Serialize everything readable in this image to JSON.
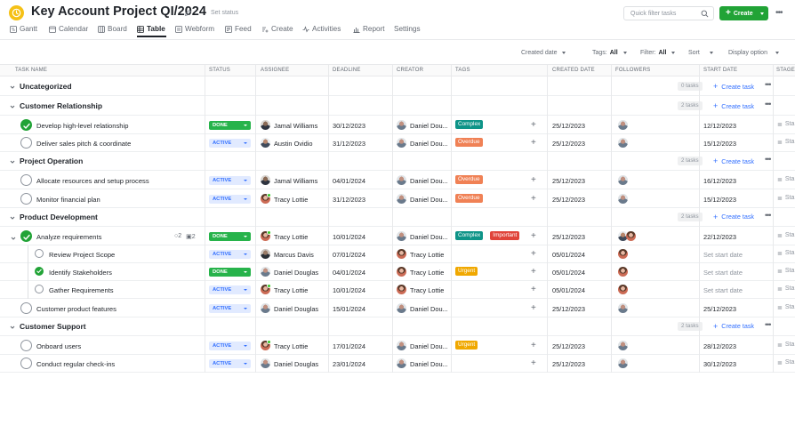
{
  "header": {
    "project_title": "Key Account Project QI/2024",
    "set_status": "Set status",
    "filter_placeholder": "Quick filter tasks",
    "create_label": "Create",
    "brand_color": "#21a336"
  },
  "nav": {
    "tabs": [
      {
        "label": "Gantt",
        "icon": "gantt-icon"
      },
      {
        "label": "Calendar",
        "icon": "calendar-icon"
      },
      {
        "label": "Board",
        "icon": "board-icon"
      },
      {
        "label": "Table",
        "icon": "table-icon",
        "active": true
      },
      {
        "label": "Webform",
        "icon": "webform-icon"
      },
      {
        "label": "Feed",
        "icon": "feed-icon"
      },
      {
        "label": "Create",
        "icon": "create-icon"
      },
      {
        "label": "Activities",
        "icon": "activities-icon"
      },
      {
        "label": "Report",
        "icon": "report-icon"
      },
      {
        "label": "Settings",
        "icon": ""
      }
    ]
  },
  "toolbar": {
    "sort_field": "Created date",
    "tags_label": "Tags:",
    "tags_value": "All",
    "filter_label": "Filter:",
    "filter_value": "All",
    "sort_label": "Sort",
    "display_label": "Display option"
  },
  "columns": [
    "TASK NAME",
    "STATUS",
    "ASSIGNEE",
    "DEADLINE",
    "CREATOR",
    "TAGS",
    "CREATED DATE",
    "FOLLOWERS",
    "START DATE",
    "STAGE"
  ],
  "groups": [
    {
      "title": "Uncategorized",
      "count": "0 tasks",
      "create": "Create task",
      "tasks": []
    },
    {
      "title": "Customer Relationship",
      "count": "2 tasks",
      "create": "Create task",
      "tasks": [
        {
          "name": "Develop high-level relationship",
          "done": true,
          "status": "DONE",
          "assignee": "Jamal Williams",
          "deadline": "30/12/2023",
          "creator": "Daniel Dou...",
          "tags": [
            "Complex"
          ],
          "created": "25/12/2023",
          "start": "12/12/2023",
          "stage": "Sta"
        },
        {
          "name": "Deliver sales pitch & coordinate",
          "done": false,
          "status": "ACTIVE",
          "assignee": "Austin Ovidio",
          "deadline": "31/12/2023",
          "creator": "Daniel Dou...",
          "tags": [
            "Overdue"
          ],
          "created": "25/12/2023",
          "start": "15/12/2023",
          "stage": "Sta"
        }
      ]
    },
    {
      "title": "Project Operation",
      "count": "2 tasks",
      "create": "Create task",
      "tasks": [
        {
          "name": "Allocate resources and setup process",
          "done": false,
          "status": "ACTIVE",
          "assignee": "Jamal Williams",
          "deadline": "04/01/2024",
          "creator": "Daniel Dou...",
          "tags": [
            "Overdue"
          ],
          "created": "25/12/2023",
          "start": "16/12/2023",
          "stage": "Sta"
        },
        {
          "name": "Monitor financial plan",
          "done": false,
          "status": "ACTIVE",
          "assignee": "Tracy Lottie",
          "deadline": "31/12/2023",
          "creator": "Daniel Dou...",
          "tags": [
            "Overdue"
          ],
          "created": "25/12/2023",
          "start": "15/12/2023",
          "stage": "Sta"
        }
      ]
    },
    {
      "title": "Product Development",
      "count": "2 tasks",
      "create": "Create task",
      "tasks": [
        {
          "name": "Analyze requirements",
          "done": true,
          "status": "DONE",
          "assignee": "Tracy Lottie",
          "deadline": "10/01/2024",
          "creator": "Daniel Dou...",
          "tags": [
            "Complex",
            "Important"
          ],
          "created": "25/12/2023",
          "start": "22/12/2023",
          "stage": "Sta",
          "comments": "2",
          "subtasks": "2"
        },
        {
          "name": "Review Project Scope",
          "sub": true,
          "done": false,
          "status": "ACTIVE",
          "assignee": "Marcus Davis",
          "deadline": "07/01/2024",
          "creator": "Tracy Lottie",
          "tags": [],
          "created": "05/01/2024",
          "start": "Set start date",
          "stage": "Sta"
        },
        {
          "name": "Identify Stakeholders",
          "sub": true,
          "done": true,
          "status": "DONE",
          "assignee": "Daniel Douglas",
          "deadline": "04/01/2024",
          "creator": "Tracy Lottie",
          "tags": [
            "Urgent"
          ],
          "created": "05/01/2024",
          "start": "Set start date",
          "stage": "Sta"
        },
        {
          "name": "Gather Requirements",
          "sub": true,
          "done": false,
          "status": "ACTIVE",
          "assignee": "Tracy Lottie",
          "deadline": "10/01/2024",
          "creator": "Tracy Lottie",
          "tags": [],
          "created": "05/01/2024",
          "start": "Set start date",
          "stage": "Sta"
        },
        {
          "name": "Customer product features",
          "done": false,
          "status": "ACTIVE",
          "assignee": "Daniel Douglas",
          "deadline": "15/01/2024",
          "creator": "Daniel Dou...",
          "tags": [],
          "created": "25/12/2023",
          "start": "25/12/2023",
          "stage": "Sta"
        }
      ]
    },
    {
      "title": "Customer Support",
      "count": "2 tasks",
      "create": "Create task",
      "tasks": [
        {
          "name": "Onboard users",
          "done": false,
          "status": "ACTIVE",
          "assignee": "Tracy Lottie",
          "deadline": "17/01/2024",
          "creator": "Daniel Dou...",
          "tags": [
            "Urgent"
          ],
          "created": "25/12/2023",
          "start": "28/12/2023",
          "stage": "Sta"
        },
        {
          "name": "Conduct regular check-ins",
          "done": false,
          "status": "ACTIVE",
          "assignee": "Daniel Douglas",
          "deadline": "23/01/2024",
          "creator": "Daniel Dou...",
          "tags": [],
          "created": "25/12/2023",
          "start": "30/12/2023",
          "stage": "Sta"
        }
      ]
    }
  ]
}
